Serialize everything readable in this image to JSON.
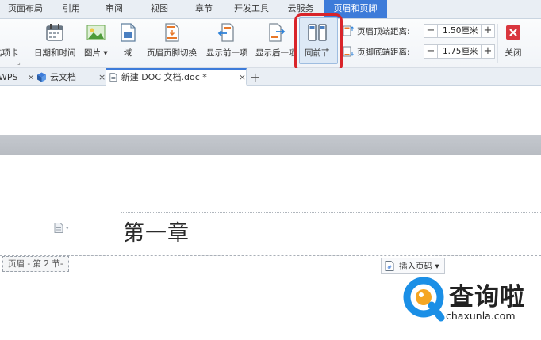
{
  "ribbon_tabs": [
    {
      "label": "页面布局"
    },
    {
      "label": "引用"
    },
    {
      "label": "审阅"
    },
    {
      "label": "视图"
    },
    {
      "label": "章节"
    },
    {
      "label": "开发工具"
    },
    {
      "label": "云服务"
    },
    {
      "label": "页眉和页脚"
    }
  ],
  "active_tab": "页眉和页脚",
  "ribbon": {
    "options_label": "选项卡",
    "date_time_label": "日期和时间",
    "picture_label": "图片 ▾",
    "field_label": "域",
    "switch_label": "页眉页脚切换",
    "show_prev_label": "显示前一项",
    "show_next_label": "显示后一项",
    "same_as_prev_label": "同前节",
    "header_top_label": "页眉顶端距离:",
    "header_top_value": "1.50厘米",
    "footer_bottom_label": "页脚底端距离:",
    "footer_bottom_value": "1.75厘米",
    "minus": "−",
    "plus": "+",
    "close_label": "关闭"
  },
  "doc_tabs": [
    {
      "label": "WPS"
    },
    {
      "label": "云文档"
    },
    {
      "label": "新建 DOC 文档.doc *"
    }
  ],
  "close_glyph": "×",
  "new_tab_glyph": "+",
  "document": {
    "chapter_text": "第一章",
    "header_label": "页眉 - 第 2 节-",
    "insert_page_number": "插入页码 ▾"
  },
  "watermark": {
    "text": "查询啦",
    "url": "chaxunla.com"
  },
  "colors": {
    "accent": "#3d7bd9",
    "highlight": "#d9242a",
    "close_button": "#d9363e",
    "watermark_blue": "#1b8fe6"
  }
}
